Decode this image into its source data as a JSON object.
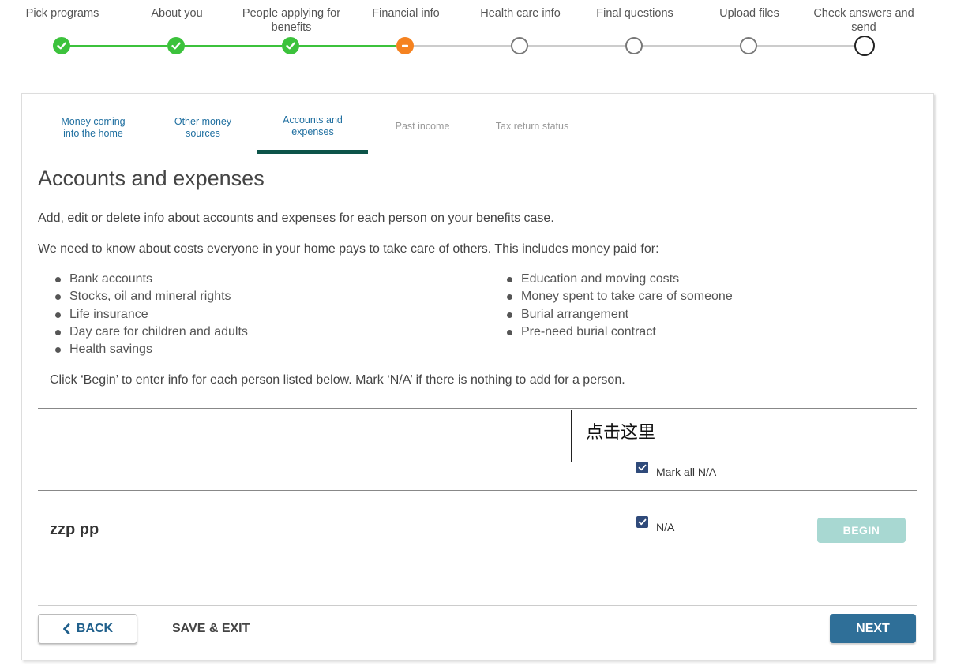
{
  "stepper": {
    "steps": [
      {
        "label": "Pick programs",
        "state": "done"
      },
      {
        "label": "About you",
        "state": "done"
      },
      {
        "label": "People applying for benefits",
        "state": "done"
      },
      {
        "label": "Financial info",
        "state": "current"
      },
      {
        "label": "Health care info",
        "state": "todo"
      },
      {
        "label": "Final questions",
        "state": "todo"
      },
      {
        "label": "Upload files",
        "state": "todo"
      },
      {
        "label": "Check answers and send",
        "state": "todo"
      }
    ]
  },
  "subtabs": [
    {
      "label": "Money coming into the home",
      "state": "enabled"
    },
    {
      "label": "Other money sources",
      "state": "enabled"
    },
    {
      "label": "Accounts and expenses",
      "state": "active"
    },
    {
      "label": "Past income",
      "state": "disabled"
    },
    {
      "label": "Tax return status",
      "state": "disabled"
    }
  ],
  "main": {
    "title": "Accounts and expenses",
    "intro": "Add, edit or delete info about accounts and expenses for each person on your benefits case.",
    "costs_intro": "We need to know about costs everyone in your home pays to take care of others. This includes money paid for:",
    "bullets_left": [
      "Bank accounts",
      "Stocks, oil and mineral rights",
      "Life insurance",
      "Day care for children and adults",
      "Health savings"
    ],
    "bullets_right": [
      "Education and moving costs",
      "Money spent to take care of someone",
      "Burial arrangement",
      "Pre-need burial contract"
    ],
    "instruction": "Click ‘Begin’ to enter info for each person listed below. Mark ‘N/A’ if there is nothing to add for a person.",
    "annotation": "点击这里",
    "mark_all_label": "Mark all N/A",
    "mark_all_checked": true,
    "person": {
      "name": "zzp pp",
      "na_label": "N/A",
      "na_checked": true,
      "begin_label": "BEGIN"
    }
  },
  "footer": {
    "back_label": "BACK",
    "save_exit_label": "SAVE & EXIT",
    "next_label": "NEXT"
  },
  "colors": {
    "done": "#3cc23c",
    "current": "#f58220",
    "primary": "#2f6f98",
    "active_tab_bar": "#0d5449",
    "begin_disabled": "#a8d8d2",
    "checkbox": "#2f4a7a"
  }
}
